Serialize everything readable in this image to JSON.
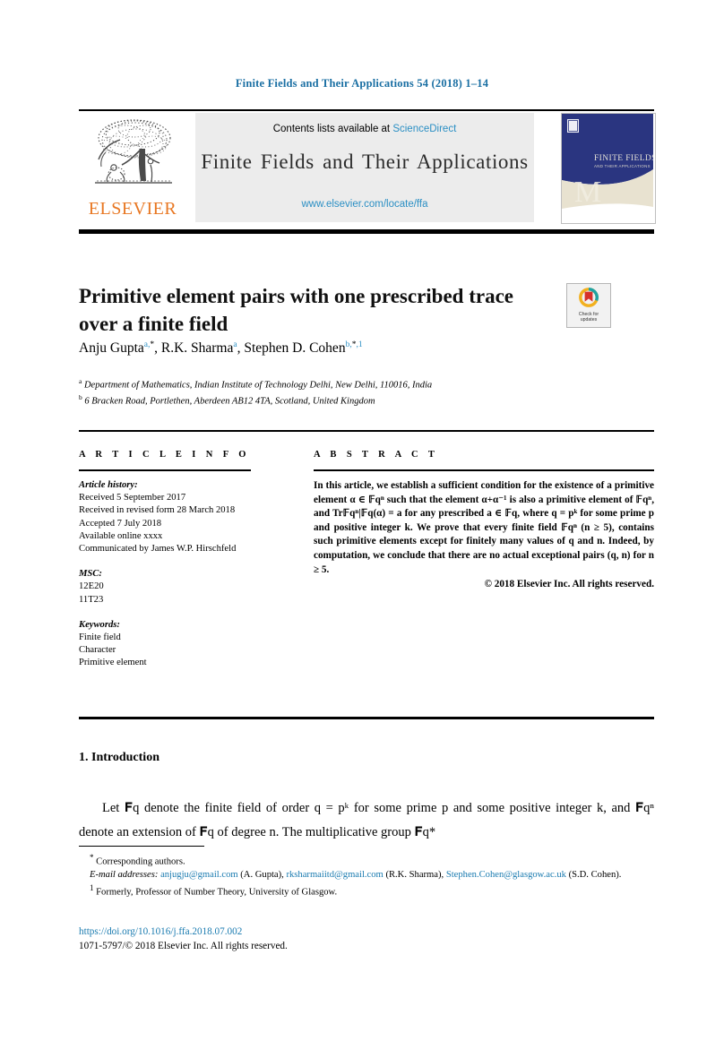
{
  "running_head": "Finite Fields and Their Applications 54 (2018) 1–14",
  "masthead": {
    "publisher_name": "ELSEVIER",
    "publisher_logo_name": "elsevier-tree-logo",
    "contents_prefix": "Contents lists available at ",
    "contents_link": "ScienceDirect",
    "journal_title": "Finite Fields and Their Applications",
    "journal_url": "www.elsevier.com/locate/ffa",
    "cover_title": "FINITE FIELDS",
    "cover_subtitle": "AND THEIR APPLICATIONS"
  },
  "article": {
    "title": "Primitive element pairs with one prescribed trace over a finite field",
    "crossmark": {
      "line1": "Check for",
      "line2": "updates"
    },
    "authors_html": "Anju Gupta<sup>a,*</sup>, R.K. Sharma<sup>a</sup>, Stephen D. Cohen<sup>b,*,1</sup>",
    "affiliations": [
      {
        "mark": "a",
        "text": "Department of Mathematics, Indian Institute of Technology Delhi, New Delhi, 110016, India"
      },
      {
        "mark": "b",
        "text": "6 Bracken Road, Portlethen, Aberdeen AB12 4TA, Scotland, United Kingdom"
      }
    ]
  },
  "info": {
    "heading": "A R T I C L E   I N F O",
    "history_label": "Article history:",
    "history": [
      "Received 5 September 2017",
      "Received in revised form 28 March 2018",
      "Accepted 7 July 2018",
      "Available online xxxx",
      "Communicated by James W.P. Hirschfeld"
    ],
    "msc_label": "MSC:",
    "msc": [
      "12E20",
      "11T23"
    ],
    "keywords_label": "Keywords:",
    "keywords": [
      "Finite field",
      "Character",
      "Primitive element"
    ]
  },
  "abstract": {
    "heading": "A B S T R A C T",
    "text": "In this article, we establish a sufficient condition for the existence of a primitive element α ∈ 𝔽qⁿ such that the element α+α⁻¹ is also a primitive element of 𝔽qⁿ, and Tr𝔽qⁿ|𝔽q(α) = a for any prescribed a ∈ 𝔽q, where q = pᵏ for some prime p and positive integer k. We prove that every finite field 𝔽qⁿ (n ≥ 5), contains such primitive elements except for finitely many values of q and n. Indeed, by computation, we conclude that there are no actual exceptional pairs (q, n) for n ≥ 5.",
    "copyright": "© 2018 Elsevier Inc. All rights reserved."
  },
  "body": {
    "section_number": "1.",
    "section_title": "Introduction",
    "paragraph": "Let 𝐅q denote the finite field of order q = pᵏ for some prime p and some positive integer k, and 𝐅qⁿ denote an extension of 𝐅q of degree n. The multiplicative group 𝐅q*"
  },
  "footnotes": {
    "corresponding_mark": "*",
    "corresponding_text": "Corresponding authors.",
    "email_label": "E-mail addresses:",
    "emails": [
      {
        "address": "anjugju@gmail.com",
        "owner": "(A. Gupta)"
      },
      {
        "address": "rksharmaiitd@gmail.com",
        "owner": "(R.K. Sharma)"
      },
      {
        "address": "Stephen.Cohen@glasgow.ac.uk",
        "owner": "(S.D. Cohen)"
      }
    ],
    "note_mark": "1",
    "note_text": "Formerly, Professor of Number Theory, University of Glasgow."
  },
  "footer": {
    "doi": "https://doi.org/10.1016/j.ffa.2018.07.002",
    "issn_line": "1071-5797/© 2018 Elsevier Inc. All rights reserved."
  },
  "colors": {
    "link": "#1a7bb0",
    "brand_orange": "#E87722",
    "cover_blue": "#2a3580",
    "running_head": "#1a6fa3"
  }
}
